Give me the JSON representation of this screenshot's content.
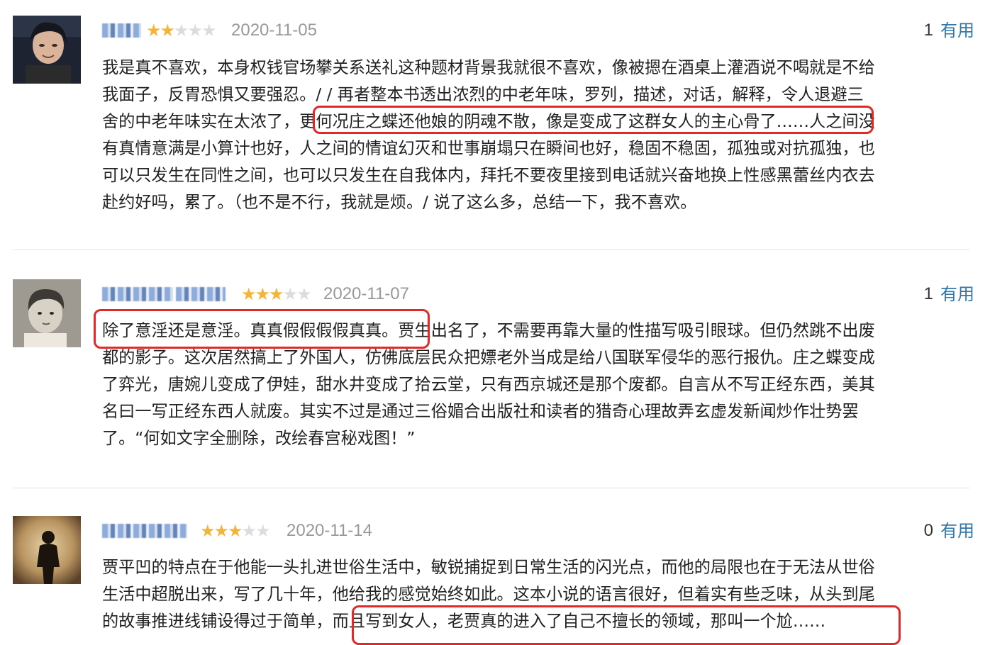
{
  "colors": {
    "star_on": "#f4b43a",
    "star_off": "#dcdcdc",
    "date": "#999999",
    "useful_link": "#3377aa",
    "highlight_box": "#e02a2a",
    "divider": "#e5e5e5"
  },
  "reviews": [
    {
      "username_blurred": true,
      "rating": 2,
      "rating_max": 5,
      "date": "2020-11-05",
      "vote_count": "1",
      "vote_label": "有用",
      "lines": [
        "我是真不喜欢，本身权钱官场攀关系送礼这种题材背景我就很不喜欢，像被摁在酒桌上灌酒说不喝就是不给",
        "我面子，反胃恐惧又要强忍。/ / 再者整本书透出浓烈的中老年味，罗列，描述，对话，解释，令人退避三",
        "舍的中老年味实在太浓了，更何况庄之蝶还他娘的阴魂不散，像是变成了这群女人的主心骨了……人之间没",
        "有真情意满是小算计也好，人之间的情谊幻灭和世事崩塌只在瞬间也好，稳固不稳固，孤独或对抗孤独，也",
        "可以只发生在同性之间，也可以只发生在自我体内，拜托不要夜里接到电话就兴奋地换上性感黑蕾丝内衣去",
        "赴约好吗，累了。（也不是不行，我就是烦。/ 说了这么多，总结一下，我不喜欢。"
      ]
    },
    {
      "username_blurred": true,
      "rating": 3,
      "rating_max": 5,
      "date": "2020-11-07",
      "vote_count": "1",
      "vote_label": "有用",
      "lines": [
        "除了意淫还是意淫。真真假假假假真真。贾生出名了，不需要再靠大量的性描写吸引眼球。但仍然跳不出废",
        "都的影子。这次居然搞上了外国人，仿佛底层民众把嫖老外当成是给八国联军侵华的恶行报仇。庄之蝶变成",
        "了弈光，唐婉儿变成了伊娃，甜水井变成了拾云堂，只有西京城还是那个废都。自言从不写正经东西，美其",
        "名曰一写正经东西人就废。其实不过是通过三俗媚合出版社和读者的猎奇心理故弄玄虚发新闻炒作壮势罢",
        "了。“何如文字全删除，改绘春宫秘戏图！”"
      ]
    },
    {
      "username_blurred": true,
      "rating": 3,
      "rating_max": 5,
      "date": "2020-11-14",
      "vote_count": "0",
      "vote_label": "有用",
      "lines": [
        "贾平凹的特点在于他能一头扎进世俗生活中，敏锐捕捉到日常生活的闪光点，而他的局限也在于无法从世俗",
        "生活中超脱出来，写了几十年，他给我的感觉始终如此。这本小说的语言很好，但着实有些乏味，从头到尾",
        "的故事推进线铺设得过于简单，而且写到女人，老贾真的进入了自己不擅长的领域，那叫一个尬……"
      ]
    }
  ]
}
